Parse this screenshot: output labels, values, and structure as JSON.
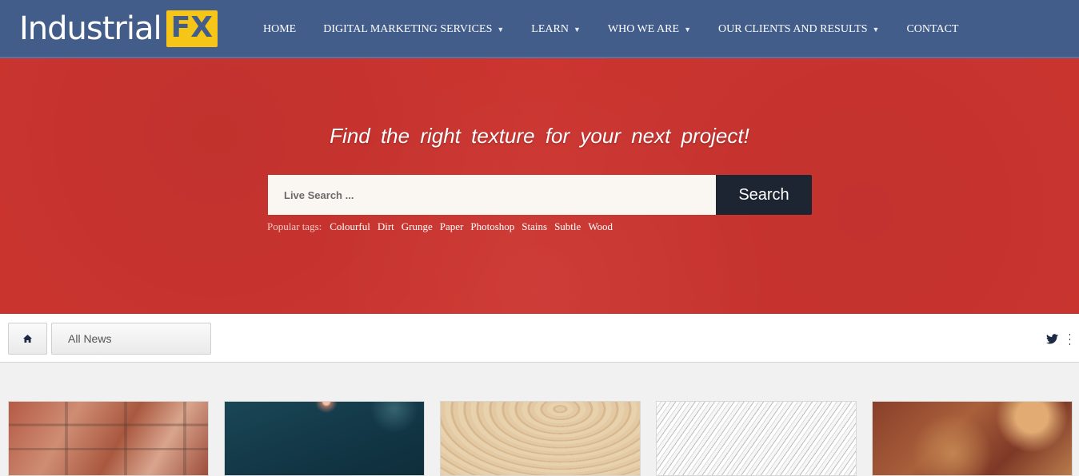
{
  "header": {
    "logo_text": "Industrial",
    "logo_badge": "FX",
    "nav": [
      {
        "label": "HOME",
        "dropdown": false
      },
      {
        "label": "DIGITAL MARKETING SERVICES",
        "dropdown": true
      },
      {
        "label": "LEARN",
        "dropdown": true
      },
      {
        "label": "WHO WE ARE",
        "dropdown": true
      },
      {
        "label": "OUR CLIENTS AND RESULTS",
        "dropdown": true
      },
      {
        "label": "CONTACT",
        "dropdown": false
      }
    ]
  },
  "hero": {
    "title": "Find the right texture for your next project!",
    "search_placeholder": "Live Search ...",
    "search_button": "Search",
    "tags_label": "Popular tags:",
    "tags": [
      "Colourful",
      "Dirt",
      "Grunge",
      "Paper",
      "Photoshop",
      "Stains",
      "Subtle",
      "Wood"
    ]
  },
  "subbar": {
    "home_icon": "home-icon",
    "filter_label": "All News",
    "social_icon": "twitter-icon",
    "more_icon": "more-vertical-icon"
  },
  "cards": [
    {
      "texture": "brick"
    },
    {
      "texture": "dark-bokeh"
    },
    {
      "texture": "wood"
    },
    {
      "texture": "scratched-metal"
    },
    {
      "texture": "rust"
    }
  ],
  "colors": {
    "header_bg": "#435d8b",
    "hero_bg": "#cd3530",
    "logo_badge_bg": "#f5c518",
    "search_button_bg": "#1d2532"
  }
}
